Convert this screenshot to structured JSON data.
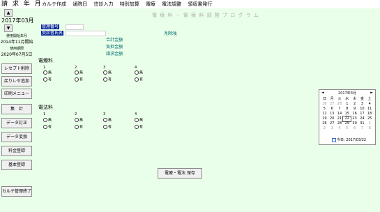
{
  "menubar": {
    "title": "請 求 年 月",
    "items": [
      "カルテ作成",
      "通院日",
      "往診入力",
      "特別加算",
      "電療",
      "電法調整",
      "領収書発行"
    ]
  },
  "sidebar": {
    "up_arrow": "▲",
    "down_arrow": "▼",
    "year_month": "2017年03月",
    "start_label": "使用開始年月",
    "start_value": "2014年11月開始",
    "end_label": "使用期限",
    "end_value": "2020年07月5日",
    "buttons": [
      "レセプト削除",
      "戻りレセ追加",
      "印刷メニュー",
      "集　計",
      "データ訂正",
      "データ変換",
      "料金登録",
      "基本登録",
      "カルテ管理終了"
    ]
  },
  "main": {
    "page_title": "電 療 料 ・ 電 療 料 調 整 プ ロ グ ラ ム",
    "patient_no_label": "管理番号",
    "patient_name_label": "受診者氏名",
    "delete_label": "削除後",
    "total_label": "合計金額",
    "burden_label": "負担金額",
    "claim_label": "請求金額",
    "sections": [
      {
        "title": "電療料",
        "cols": [
          "1",
          "2",
          "3",
          "4"
        ],
        "options": [
          "無",
          "有"
        ]
      },
      {
        "title": "電法料",
        "cols": [
          "1",
          "2",
          "3",
          "4"
        ],
        "options": [
          "無",
          "有"
        ]
      }
    ],
    "save_button": "電療・電法 保存"
  },
  "calendar": {
    "header": "2017年3月",
    "prev": "◄",
    "next": "►",
    "weekdays": [
      "日",
      "月",
      "火",
      "水",
      "木",
      "金",
      "土"
    ],
    "weeks": [
      [
        "26",
        "27",
        "28",
        "1",
        "2",
        "3",
        "4"
      ],
      [
        "5",
        "6",
        "7",
        "8",
        "9",
        "10",
        "11"
      ],
      [
        "12",
        "13",
        "14",
        "15",
        "16",
        "17",
        "18"
      ],
      [
        "19",
        "20",
        "21",
        "22",
        "23",
        "24",
        "25"
      ],
      [
        "26",
        "27",
        "28",
        "29",
        "30",
        "31",
        "1"
      ],
      [
        "2",
        "3",
        "4",
        "5",
        "6",
        "7",
        "8"
      ]
    ],
    "today_label": "今日: 2017/03/22"
  }
}
